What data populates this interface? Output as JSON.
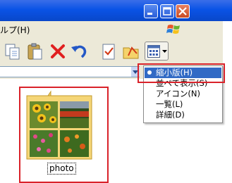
{
  "menubar": {
    "help_label": "ルプ(H)"
  },
  "icons": {
    "minimize": "minimize-icon",
    "maximize": "maximize-icon",
    "close": "close-icon",
    "windows_logo": "windows-logo-icon",
    "copy": "copy-icon",
    "paste": "paste-icon",
    "delete": "delete-icon",
    "undo": "undo-icon",
    "properties": "properties-icon",
    "folders": "folders-icon",
    "views": "views-icon"
  },
  "view_menu": {
    "items": [
      {
        "label": "縮小版(H)",
        "selected": true
      },
      {
        "label": "並べて表示(S)",
        "selected": false
      },
      {
        "label": "アイコン(N)",
        "selected": false
      },
      {
        "label": "一覧(L)",
        "selected": false
      },
      {
        "label": "詳細(D)",
        "selected": false
      }
    ]
  },
  "folder": {
    "name": "photo"
  },
  "colors": {
    "titlebar": "#0a53e6",
    "menu_selection": "#316ac5",
    "annotation": "#d9222a",
    "chrome": "#ece9d8"
  }
}
